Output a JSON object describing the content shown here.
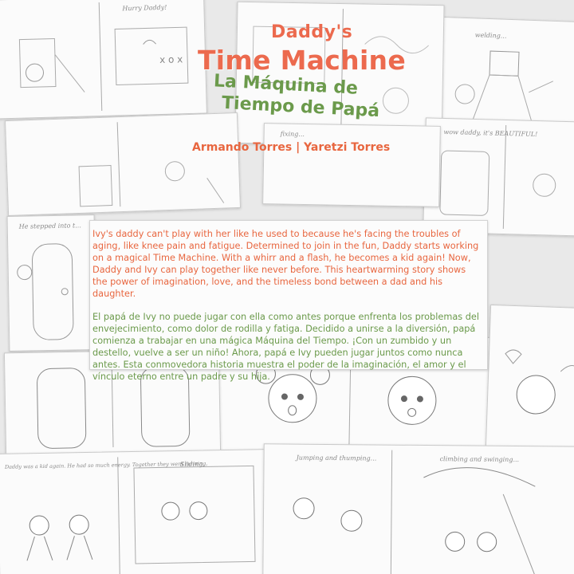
{
  "cover": {
    "title_line1": "Daddy's",
    "title_line2": "Time Machine",
    "title_es_line1": "La Máquina de",
    "title_es_line2": "Tiempo de Papá",
    "authors": "Armando Torres | Yaretzi Torres",
    "colors": {
      "title_en": "#ec6a4e",
      "title_es": "#6b9a4b",
      "desc_en": "#e8663f",
      "desc_es": "#6b9a4b"
    }
  },
  "description": {
    "english": "Ivy's daddy can't play with her like he used to because he's facing the troubles of aging, like knee pain and fatigue. Determined to join in the fun, Daddy starts working on a magical Time Machine. With a whirr and a flash, he becomes a kid again! Now, Daddy and Ivy can play together like never before. This heartwarming story shows the power of imagination, love, and the timeless bond between a dad and his daughter.",
    "spanish": "El papá de Ivy no puede jugar con ella como antes porque enfrenta los problemas del envejecimiento, como dolor de rodilla y fatiga. Decidido a unirse a la diversión, papá comienza a trabajar en una mágica Máquina del Tiempo. ¡Con un zumbido y un destello, vuelve a ser un niño! Ahora, papá e Ivy pueden jugar juntos como nunca antes. Esta conmovedora historia muestra el poder de la imaginación, el amor y el vínculo eterno entre un padre y su hija."
  },
  "sketch_captions": {
    "hurry_daddy": "Hurry Daddy!",
    "welding": "welding...",
    "fixing": "fixing...",
    "wow_daddy": "wow daddy, it's BEAUTIFUL!",
    "stepped_into": "He stepped into t...",
    "daddy_kid_again": "Daddy was a kid again. He had so much energy. Together they went running,",
    "sliding": "Sliding,",
    "jumping": "Jumping and thumping...",
    "climbing": "climbing and swinging..."
  }
}
